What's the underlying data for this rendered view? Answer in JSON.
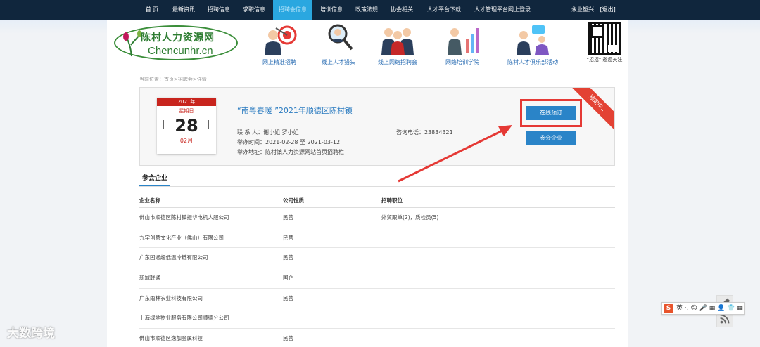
{
  "nav": {
    "items": [
      "首 页",
      "最新资讯",
      "招聘信息",
      "求职信息",
      "招聘会信息",
      "培训信息",
      "政策法规",
      "协会相关",
      "人才平台下载",
      "人才管理平台网上登录"
    ],
    "active_index": 4,
    "user_name": "永业塑兴",
    "logout": "[退出]"
  },
  "logo": {
    "cn": "陈村人力资源网",
    "en": "Chencunhr.cn"
  },
  "services": [
    "网上精准招聘",
    "线上人才猎头",
    "线上网络招聘会",
    "网络培训学院",
    "陈村人才俱乐部活动"
  ],
  "qr_label": "\"招招\" 邀您关注",
  "breadcrumb": "当前位置：首页>招聘会>详情",
  "event": {
    "cal_year": "2021年",
    "cal_weekday": "星期日",
    "cal_day": "28",
    "cal_month": "02月",
    "title": "“南粤春暖 ”2021年顺德区陈村镇",
    "contact": "联 系 人：谢小姐 罗小姐",
    "phone": "咨询电话：23834321",
    "time": "举办时间：2021-02-28 至 2021-03-12",
    "address": "举办地址：陈村镇人力资源网站首页招聘栏",
    "book_button": "在线预订",
    "companies_button": "参会企业",
    "ribbon": "预定中..."
  },
  "section_tab": "参会企业",
  "table": {
    "headers": [
      "企业名称",
      "公司性质",
      "招聘职位"
    ],
    "rows": [
      [
        "佛山市顺德区陈村镇振华电机人服公司",
        "民营",
        "外贸跟单(2)，质检员(5)"
      ],
      [
        "九宇创意文化产业（佛山）有限公司",
        "民营",
        ""
      ],
      [
        "广东国通超低温冷链有限公司",
        "民营",
        ""
      ],
      [
        "新城联通",
        "国企",
        ""
      ],
      [
        "广东雨林农业科技有限公司",
        "民营",
        ""
      ],
      [
        "上海绿地物业服务有限公司顺德分公司",
        "",
        ""
      ],
      [
        "佛山市顺德区逸加金属科技",
        "民营",
        ""
      ]
    ]
  },
  "ime_label": "英 ·, ☺ 🎤 ▦ 👤 👕 ▦",
  "watermark": "大数跨境",
  "colors": {
    "nav_bg": "#10263d",
    "accent": "#2a84c8",
    "red": "#e53935",
    "calendar_red": "#c8251e"
  }
}
